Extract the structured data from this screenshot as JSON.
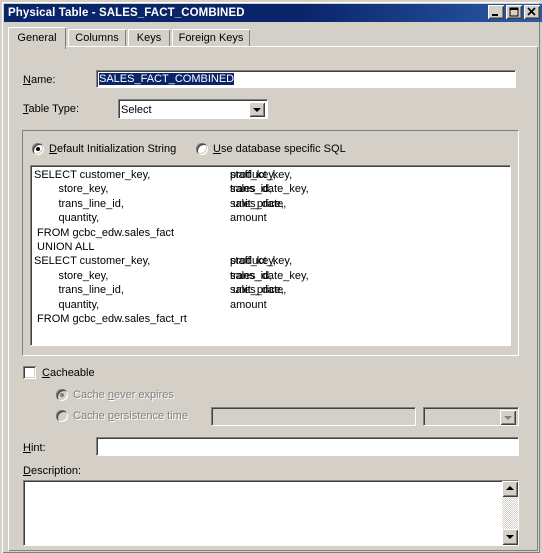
{
  "window": {
    "title": "Physical Table - SALES_FACT_COMBINED",
    "minimize_label": "Minimize",
    "maximize_label": "Maximize",
    "close_label": "Close"
  },
  "tabs": [
    {
      "label": "General",
      "selected": true
    },
    {
      "label": "Columns",
      "selected": false
    },
    {
      "label": "Keys",
      "selected": false
    },
    {
      "label": "Foreign Keys",
      "selected": false
    }
  ],
  "general": {
    "name_label": "Name:",
    "name_value": "SALES_FACT_COMBINED",
    "name_selected": true,
    "table_type_label": "Table Type:",
    "table_type_value": "Select",
    "table_type_options": [
      "Select"
    ],
    "init_string_radio": "Default Initialization String",
    "db_specific_radio": "Use database specific SQL",
    "init_string_selected": true,
    "sql_text": "SELECT customer_key,\t\tproduct_key,\t\tstaff_key,\n        store_key,\t\tsales_date_key,\ttrans_id,\n        trans_line_id,\t\tsales_date,\t\t unit_price,\n        quantity,\t\tamount\n FROM gcbc_edw.sales_fact\n UNION ALL\nSELECT customer_key,\t\tproduct_key,\t\tstaff_key,\n        store_key,\t\tsales_date_key,\ttrans_id,\n        trans_line_id,\t\tsales_date,\t\t unit_price,\n        quantity,\t\tamount\n FROM gcbc_edw.sales_fact_rt",
    "cacheable_label": "Cacheable",
    "cacheable_checked": false,
    "cache_never_expires_label": "Cache never expires",
    "cache_never_expires_selected": true,
    "cache_persistence_label": "Cache persistence time",
    "cache_persistence_selected": false,
    "cache_persistence_value": "",
    "cache_persistence_unit_value": "",
    "hint_label": "Hint:",
    "hint_value": "",
    "description_label": "Description:",
    "description_value": ""
  },
  "colors": {
    "titlebar_start": "#0a246a",
    "titlebar_end": "#2a5ba8",
    "face": "#d4d0c8",
    "selection": "#0a246a",
    "field": "#ffffff",
    "disabled_text": "#808080"
  }
}
